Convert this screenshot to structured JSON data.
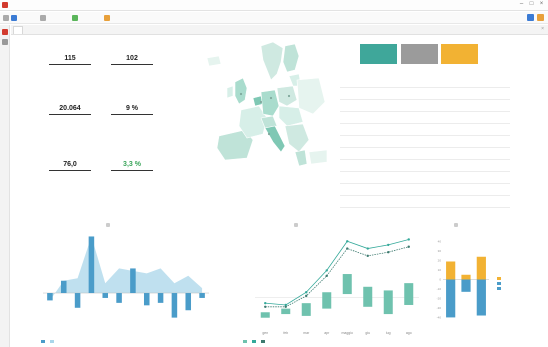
{
  "window": {
    "title": "",
    "controls": [
      "–",
      "□",
      "×"
    ]
  },
  "toolbar": {
    "items": [
      "",
      "",
      "",
      ""
    ]
  },
  "tab": {
    "label": ""
  },
  "kpis": [
    {
      "title": "",
      "value": "115",
      "delta": ""
    },
    {
      "title": "",
      "value": "102",
      "delta": ""
    },
    {
      "title": "",
      "value": "20.064",
      "delta": ""
    },
    {
      "title": "",
      "value": "9 %",
      "delta": ""
    },
    {
      "title": "",
      "value": "76,0",
      "delta": ""
    },
    {
      "title": "",
      "value": "3,3 %",
      "delta": ""
    }
  ],
  "tiles": [
    {
      "header": "",
      "value": "",
      "color": "#3fa79a"
    },
    {
      "header": "",
      "value": "",
      "color": "#9b9b9b"
    },
    {
      "header": "",
      "value": "",
      "color": "#f2b233"
    }
  ],
  "table": {
    "rows": [
      {
        "c0": "",
        "c1": "",
        "c2": "",
        "c3": "",
        "neg": false
      },
      {
        "c0": "",
        "c1": "",
        "c2": "",
        "c3": "",
        "neg": false
      },
      {
        "c0": "",
        "c1": "",
        "c2": "",
        "c3": "",
        "neg": false
      },
      {
        "c0": "",
        "c1": "",
        "c2": "",
        "c3": "",
        "neg": false
      },
      {
        "c0": "",
        "c1": "",
        "c2": "",
        "c3": "",
        "neg": true
      },
      {
        "c0": "",
        "c1": "",
        "c2": "",
        "c3": "",
        "neg": false
      },
      {
        "c0": "",
        "c1": "",
        "c2": "",
        "c3": "",
        "neg": false
      },
      {
        "c0": "",
        "c1": "",
        "c2": "",
        "c3": "",
        "neg": true
      },
      {
        "c0": "",
        "c1": "",
        "c2": "",
        "c3": "",
        "neg": false
      },
      {
        "c0": "",
        "c1": "",
        "c2": "",
        "c3": "",
        "neg": false
      },
      {
        "c0": "",
        "c1": "",
        "c2": "",
        "c3": "",
        "neg": false
      }
    ]
  },
  "panels": {
    "left_title": "",
    "mid_title": "",
    "right_title": ""
  },
  "chart_data": [
    {
      "type": "bar",
      "title": "",
      "categories": [
        "",
        "",
        "",
        "",
        "",
        "",
        "",
        "",
        "",
        "",
        "",
        ""
      ],
      "series": [
        {
          "name": "",
          "values": [
            -0.3,
            0.5,
            -0.6,
            2.3,
            -0.2,
            -0.4,
            1.0,
            -0.5,
            -0.4,
            -1.0,
            -0.7,
            -0.2
          ],
          "color": "#4a9cc9"
        },
        {
          "name": "",
          "values": [
            -0.3,
            0.5,
            0.6,
            2.3,
            0.4,
            1.0,
            0.9,
            0.8,
            1.0,
            0.4,
            0.7,
            0.2
          ],
          "color": "#a9d6ea"
        }
      ],
      "ylim": [
        -1.3,
        2.4
      ]
    },
    {
      "type": "bar",
      "title": "",
      "categories": [
        "gen",
        "feb",
        "mar",
        "apr",
        "maggio",
        "giu",
        "lug",
        "ago"
      ],
      "series": [
        {
          "name": "",
          "values": [
            -0.8,
            -0.6,
            -0.3,
            0.3,
            1.3,
            0.6,
            0.4,
            0.8
          ],
          "color": "#6fc2ae"
        },
        {
          "name": "",
          "values": [
            -0.3,
            -0.4,
            0.3,
            1.5,
            3.1,
            2.7,
            2.9,
            3.2
          ],
          "color": "#34a99a"
        },
        {
          "name": "",
          "values": [
            -0.5,
            -0.5,
            0.1,
            1.2,
            2.7,
            2.3,
            2.5,
            2.8
          ],
          "color": "#3d7a6f"
        }
      ],
      "ylim": [
        -1.5,
        3.5
      ]
    },
    {
      "type": "bar",
      "title": "",
      "categories": [
        "",
        "",
        ""
      ],
      "series": [
        {
          "name": "",
          "values": [
            19,
            5,
            24
          ],
          "color": "#f2b233"
        },
        {
          "name": "",
          "values": [
            0,
            0,
            0
          ],
          "color": "#4a9cc9"
        },
        {
          "name": "",
          "values": [
            -40,
            -13,
            -38
          ],
          "color": "#4a9cc9"
        }
      ],
      "ylim": [
        -48,
        48
      ]
    }
  ]
}
